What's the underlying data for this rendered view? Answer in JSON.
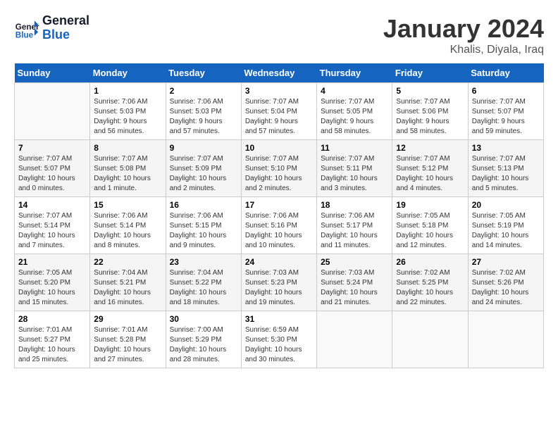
{
  "header": {
    "logo_line1": "General",
    "logo_line2": "Blue",
    "title": "January 2024",
    "location": "Khalis, Diyala, Iraq"
  },
  "calendar": {
    "days_of_week": [
      "Sunday",
      "Monday",
      "Tuesday",
      "Wednesday",
      "Thursday",
      "Friday",
      "Saturday"
    ],
    "weeks": [
      [
        {
          "day": "",
          "info": ""
        },
        {
          "day": "1",
          "info": "Sunrise: 7:06 AM\nSunset: 5:03 PM\nDaylight: 9 hours\nand 56 minutes."
        },
        {
          "day": "2",
          "info": "Sunrise: 7:06 AM\nSunset: 5:03 PM\nDaylight: 9 hours\nand 57 minutes."
        },
        {
          "day": "3",
          "info": "Sunrise: 7:07 AM\nSunset: 5:04 PM\nDaylight: 9 hours\nand 57 minutes."
        },
        {
          "day": "4",
          "info": "Sunrise: 7:07 AM\nSunset: 5:05 PM\nDaylight: 9 hours\nand 58 minutes."
        },
        {
          "day": "5",
          "info": "Sunrise: 7:07 AM\nSunset: 5:06 PM\nDaylight: 9 hours\nand 58 minutes."
        },
        {
          "day": "6",
          "info": "Sunrise: 7:07 AM\nSunset: 5:07 PM\nDaylight: 9 hours\nand 59 minutes."
        }
      ],
      [
        {
          "day": "7",
          "info": "Sunrise: 7:07 AM\nSunset: 5:07 PM\nDaylight: 10 hours\nand 0 minutes."
        },
        {
          "day": "8",
          "info": "Sunrise: 7:07 AM\nSunset: 5:08 PM\nDaylight: 10 hours\nand 1 minute."
        },
        {
          "day": "9",
          "info": "Sunrise: 7:07 AM\nSunset: 5:09 PM\nDaylight: 10 hours\nand 2 minutes."
        },
        {
          "day": "10",
          "info": "Sunrise: 7:07 AM\nSunset: 5:10 PM\nDaylight: 10 hours\nand 2 minutes."
        },
        {
          "day": "11",
          "info": "Sunrise: 7:07 AM\nSunset: 5:11 PM\nDaylight: 10 hours\nand 3 minutes."
        },
        {
          "day": "12",
          "info": "Sunrise: 7:07 AM\nSunset: 5:12 PM\nDaylight: 10 hours\nand 4 minutes."
        },
        {
          "day": "13",
          "info": "Sunrise: 7:07 AM\nSunset: 5:13 PM\nDaylight: 10 hours\nand 5 minutes."
        }
      ],
      [
        {
          "day": "14",
          "info": "Sunrise: 7:07 AM\nSunset: 5:14 PM\nDaylight: 10 hours\nand 7 minutes."
        },
        {
          "day": "15",
          "info": "Sunrise: 7:06 AM\nSunset: 5:14 PM\nDaylight: 10 hours\nand 8 minutes."
        },
        {
          "day": "16",
          "info": "Sunrise: 7:06 AM\nSunset: 5:15 PM\nDaylight: 10 hours\nand 9 minutes."
        },
        {
          "day": "17",
          "info": "Sunrise: 7:06 AM\nSunset: 5:16 PM\nDaylight: 10 hours\nand 10 minutes."
        },
        {
          "day": "18",
          "info": "Sunrise: 7:06 AM\nSunset: 5:17 PM\nDaylight: 10 hours\nand 11 minutes."
        },
        {
          "day": "19",
          "info": "Sunrise: 7:05 AM\nSunset: 5:18 PM\nDaylight: 10 hours\nand 12 minutes."
        },
        {
          "day": "20",
          "info": "Sunrise: 7:05 AM\nSunset: 5:19 PM\nDaylight: 10 hours\nand 14 minutes."
        }
      ],
      [
        {
          "day": "21",
          "info": "Sunrise: 7:05 AM\nSunset: 5:20 PM\nDaylight: 10 hours\nand 15 minutes."
        },
        {
          "day": "22",
          "info": "Sunrise: 7:04 AM\nSunset: 5:21 PM\nDaylight: 10 hours\nand 16 minutes."
        },
        {
          "day": "23",
          "info": "Sunrise: 7:04 AM\nSunset: 5:22 PM\nDaylight: 10 hours\nand 18 minutes."
        },
        {
          "day": "24",
          "info": "Sunrise: 7:03 AM\nSunset: 5:23 PM\nDaylight: 10 hours\nand 19 minutes."
        },
        {
          "day": "25",
          "info": "Sunrise: 7:03 AM\nSunset: 5:24 PM\nDaylight: 10 hours\nand 21 minutes."
        },
        {
          "day": "26",
          "info": "Sunrise: 7:02 AM\nSunset: 5:25 PM\nDaylight: 10 hours\nand 22 minutes."
        },
        {
          "day": "27",
          "info": "Sunrise: 7:02 AM\nSunset: 5:26 PM\nDaylight: 10 hours\nand 24 minutes."
        }
      ],
      [
        {
          "day": "28",
          "info": "Sunrise: 7:01 AM\nSunset: 5:27 PM\nDaylight: 10 hours\nand 25 minutes."
        },
        {
          "day": "29",
          "info": "Sunrise: 7:01 AM\nSunset: 5:28 PM\nDaylight: 10 hours\nand 27 minutes."
        },
        {
          "day": "30",
          "info": "Sunrise: 7:00 AM\nSunset: 5:29 PM\nDaylight: 10 hours\nand 28 minutes."
        },
        {
          "day": "31",
          "info": "Sunrise: 6:59 AM\nSunset: 5:30 PM\nDaylight: 10 hours\nand 30 minutes."
        },
        {
          "day": "",
          "info": ""
        },
        {
          "day": "",
          "info": ""
        },
        {
          "day": "",
          "info": ""
        }
      ]
    ]
  }
}
